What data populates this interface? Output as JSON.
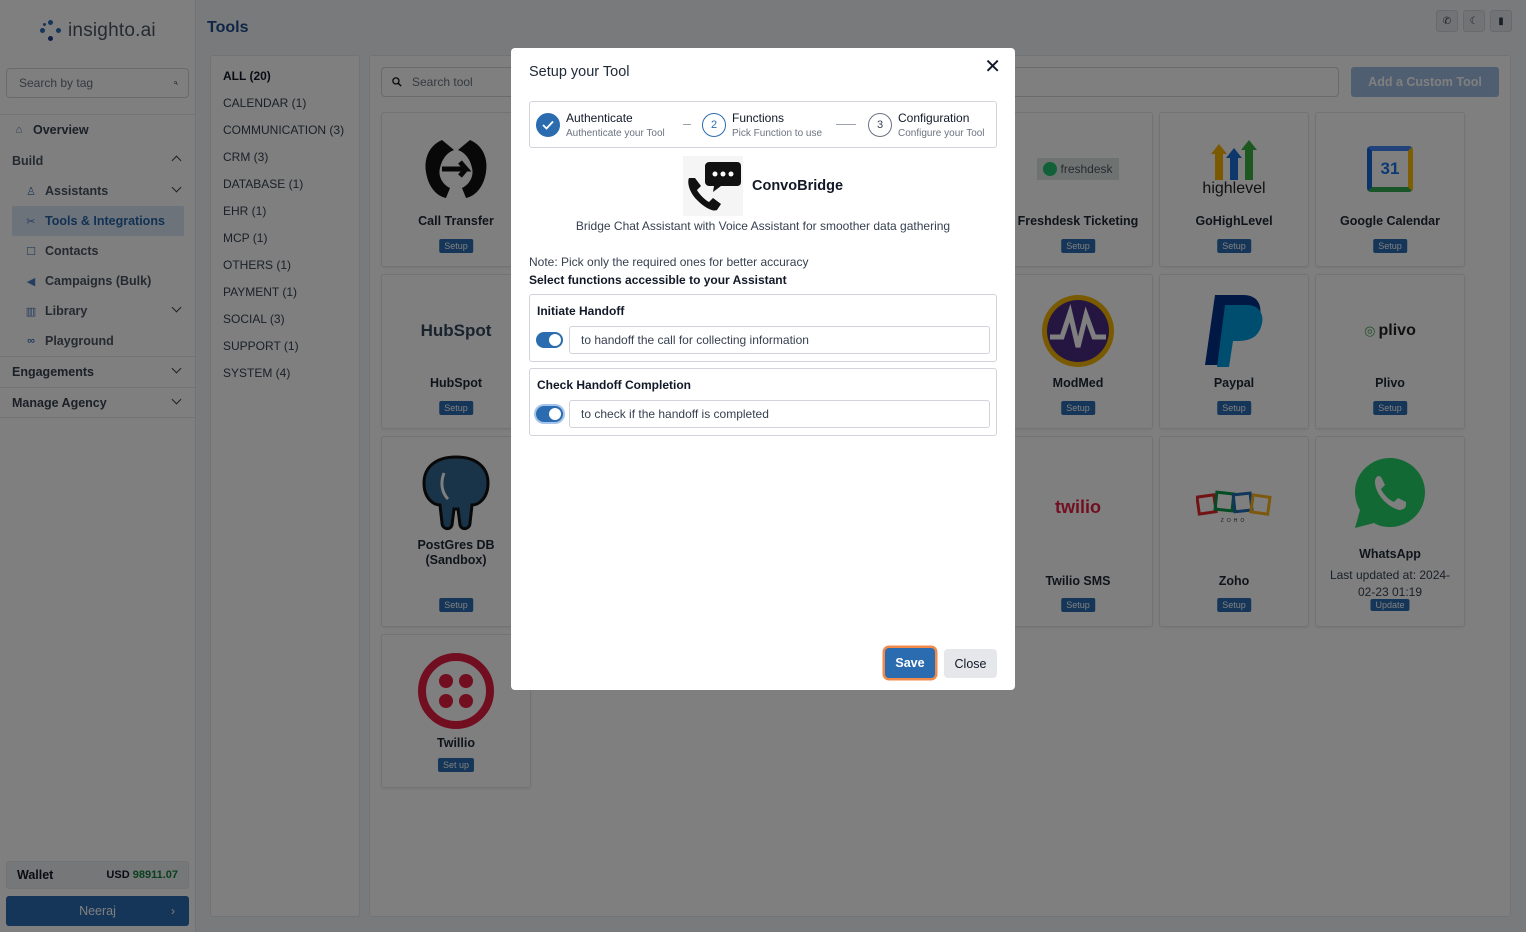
{
  "app": {
    "logo_text": "insighto.ai",
    "page_title": "Tools"
  },
  "sidebar": {
    "search_placeholder": "Search by tag",
    "overview": "Overview",
    "build": "Build",
    "assistants": "Assistants",
    "tools": "Tools & Integrations",
    "contacts": "Contacts",
    "campaigns": "Campaigns (Bulk)",
    "library": "Library",
    "playground": "Playground",
    "engagements": "Engagements",
    "manage_agency": "Manage Agency",
    "wallet_label": "Wallet",
    "wallet_currency": "USD",
    "wallet_amount": "98911.07",
    "user_name": "Neeraj"
  },
  "categories": [
    "ALL (20)",
    "CALENDAR (1)",
    "COMMUNICATION (3)",
    "CRM (3)",
    "DATABASE (1)",
    "EHR (1)",
    "MCP (1)",
    "OTHERS (1)",
    "PAYMENT (1)",
    "SOCIAL (3)",
    "SUPPORT (1)",
    "SYSTEM (4)"
  ],
  "tools_panel": {
    "search_placeholder": "Search tool",
    "add_button": "Add a Custom Tool",
    "cards": {
      "call_transfer": {
        "name": "Call Transfer",
        "action": "Setup"
      },
      "freshdesk": {
        "name": "Freshdesk Ticketing",
        "action": "Setup",
        "logo_text": "freshdesk"
      },
      "gohighlevel": {
        "name": "GoHighLevel",
        "action": "Setup",
        "logo_text": "highlevel"
      },
      "google_calendar": {
        "name": "Google Calendar",
        "action": "Setup",
        "logo_text": "31"
      },
      "hubspot": {
        "name": "HubSpot",
        "action": "Setup",
        "logo_text": "HubSpot"
      },
      "modmed": {
        "name": "ModMed",
        "action": "Setup"
      },
      "paypal": {
        "name": "Paypal",
        "action": "Setup"
      },
      "plivo": {
        "name": "Plivo",
        "action": "Setup",
        "logo_text": "plivo"
      },
      "postgres": {
        "name": "PostGres DB (Sandbox)",
        "action": "Setup"
      },
      "twilio_sms": {
        "name": "Twilio SMS",
        "action": "Setup",
        "logo_text": "twilio"
      },
      "zoho": {
        "name": "Zoho",
        "action": "Setup",
        "logo_text": "ZOHO"
      },
      "whatsapp": {
        "name": "WhatsApp",
        "action": "Update",
        "updated": "Last updated at: 2024-02-23 01:19"
      },
      "twillio": {
        "name": "Twillio",
        "action": "Set up"
      }
    }
  },
  "modal": {
    "title": "Setup your Tool",
    "steps": [
      {
        "number": "1",
        "title": "Authenticate",
        "subtitle": "Authenticate your Tool"
      },
      {
        "number": "2",
        "title": "Functions",
        "subtitle": "Pick Function to use"
      },
      {
        "number": "3",
        "title": "Configuration",
        "subtitle": "Configure your Tool"
      }
    ],
    "tool_name": "ConvoBridge",
    "tool_description": "Bridge Chat Assistant with Voice Assistant for smoother data gathering",
    "note": "Note: Pick only the required ones for better accuracy",
    "select_label": "Select functions accessible to your Assistant",
    "functions": [
      {
        "title": "Initiate Handoff",
        "description": "to handoff the call for collecting information",
        "enabled": true
      },
      {
        "title": "Check Handoff Completion",
        "description": "to check if the handoff is completed",
        "enabled": true
      }
    ],
    "save_label": "Save",
    "close_label": "Close"
  },
  "colors": {
    "primary": "#2b6cb0",
    "title_blue": "#1e4d8c",
    "focus_ring": "#f08a4b",
    "wallet_green": "#15803d"
  }
}
